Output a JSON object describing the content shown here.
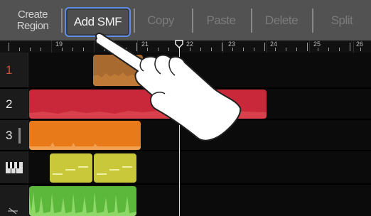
{
  "toolbar": {
    "create_region_line1": "Create",
    "create_region_line2": "Region",
    "add_smf": "Add SMF",
    "copy": "Copy",
    "paste": "Paste",
    "delete": "Delete",
    "split": "Split"
  },
  "ruler": {
    "bars": [
      "19",
      "21",
      "22",
      "23",
      "24",
      "25",
      "26"
    ]
  },
  "tracks": [
    {
      "label": "1",
      "label_color": "#d0503a",
      "region_color": "#a86a2e"
    },
    {
      "label": "2",
      "label_color": "#e8e8e8",
      "region_color": "#c8283a"
    },
    {
      "label": "3",
      "label_color": "#e8e8e8",
      "region_color": "#e87a1a"
    },
    {
      "label_icon": "piano-keys-icon",
      "region_color": "#c8c83a"
    },
    {
      "label_icon": "drum-icon",
      "region_color": "#5cb83a"
    }
  ],
  "colors": {
    "toolbar_bg": "#525252",
    "highlight_border": "#5e8fe8"
  },
  "overlay": {
    "icon": "pointing-hand-icon"
  }
}
